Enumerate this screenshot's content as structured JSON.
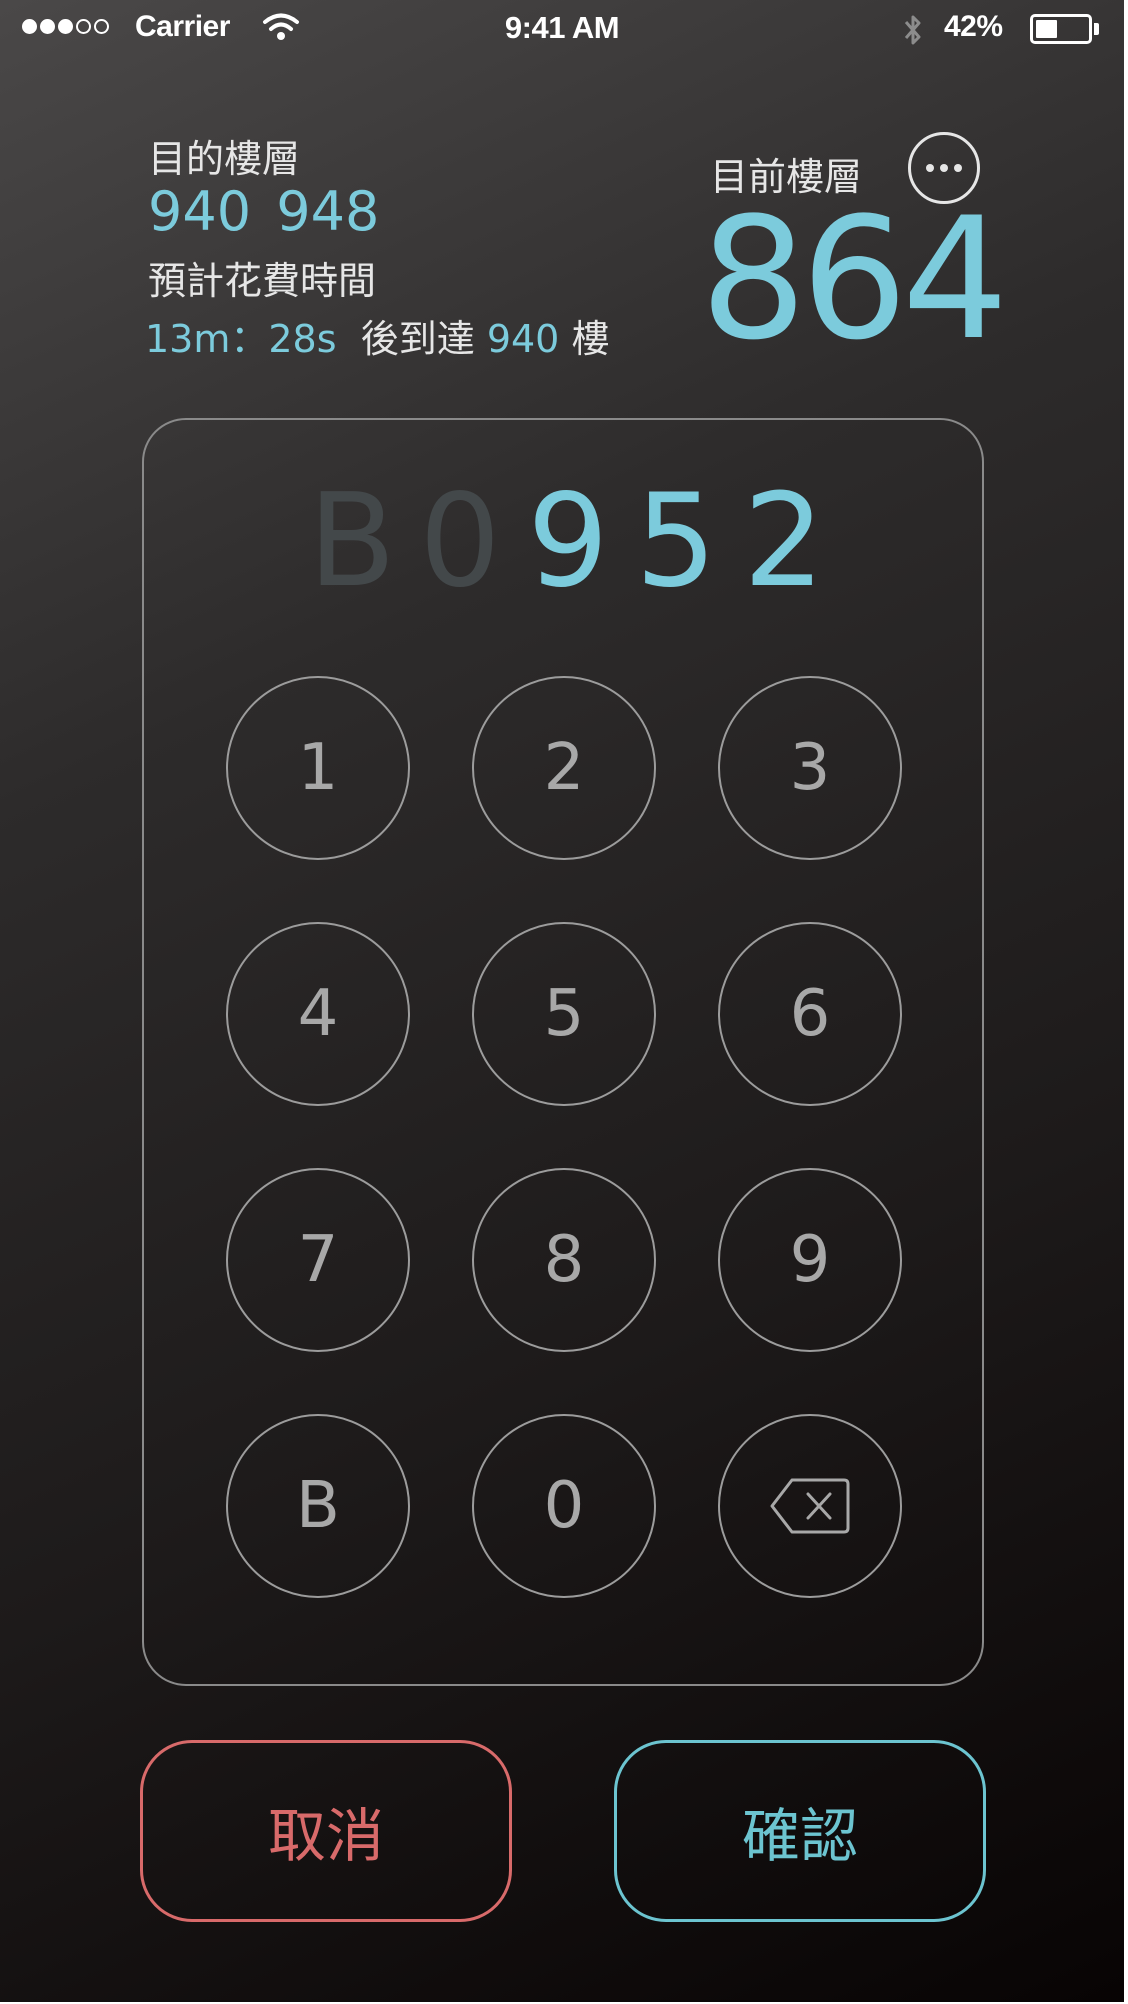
{
  "status_bar": {
    "carrier": "Carrier",
    "time": "9:41 AM",
    "battery_percent": "42%",
    "battery_level": 0.42,
    "signal_bars_filled": 3,
    "signal_bars_total": 5,
    "icons": [
      "wifi-icon",
      "bluetooth-icon",
      "battery-icon"
    ]
  },
  "destination": {
    "label": "目的樓層",
    "floors": "940 948"
  },
  "eta": {
    "label": "預計花費時間",
    "time": "13m：28s",
    "arrive_text": "後到達",
    "floor": "940",
    "floor_suffix": "樓"
  },
  "current": {
    "label": "目前樓層",
    "floor": "864",
    "more_icon": "more-icon"
  },
  "input": {
    "digits": [
      "B",
      "0",
      "9",
      "5",
      "2"
    ],
    "active_from_index": 2
  },
  "keypad": {
    "keys": [
      "1",
      "2",
      "3",
      "4",
      "5",
      "6",
      "7",
      "8",
      "9",
      "B",
      "0"
    ],
    "backspace_icon": "backspace-icon"
  },
  "actions": {
    "cancel_label": "取消",
    "confirm_label": "確認"
  },
  "colors": {
    "accent": "#7ccbdc",
    "cancel": "#d86a6a",
    "confirm": "#6cc4d0",
    "ghost_digit": "#43484a"
  }
}
